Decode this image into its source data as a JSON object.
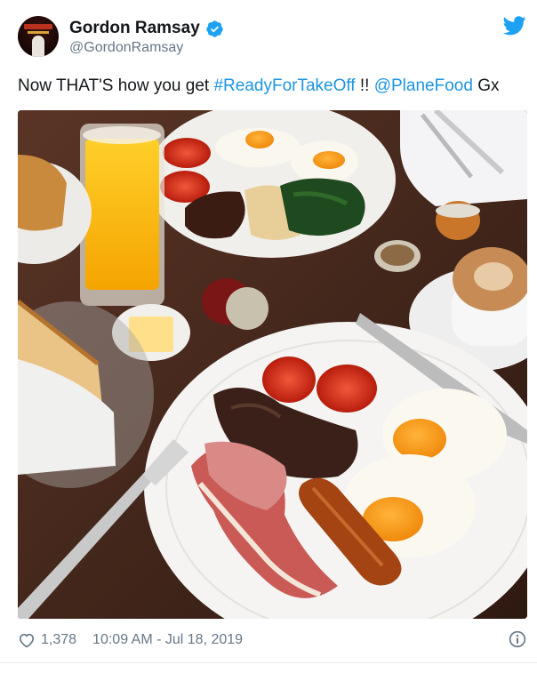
{
  "user": {
    "display_name": "Gordon Ramsay",
    "handle": "@GordonRamsay",
    "verified": true
  },
  "tweet": {
    "text_prefix": "Now THAT'S how you get ",
    "hashtag": "#ReadyForTakeOff",
    "text_middle": " !! ",
    "mention": "@PlaneFood",
    "text_suffix": " Gx"
  },
  "photo": {
    "subject": "full English breakfast: eggs, bacon, sausage, mushrooms, tomatoes, toast, orange juice, coffee"
  },
  "footer": {
    "like_count": "1,378",
    "timestamp": "10:09 AM - Jul 18, 2019"
  },
  "icons": {
    "verified": "verified-badge-icon",
    "twitter": "twitter-bird-icon",
    "like": "heart-icon",
    "info": "info-icon"
  },
  "colors": {
    "link": "#1b95e0",
    "muted": "#657786",
    "text": "#14171a",
    "verified": "#1da1f2"
  }
}
